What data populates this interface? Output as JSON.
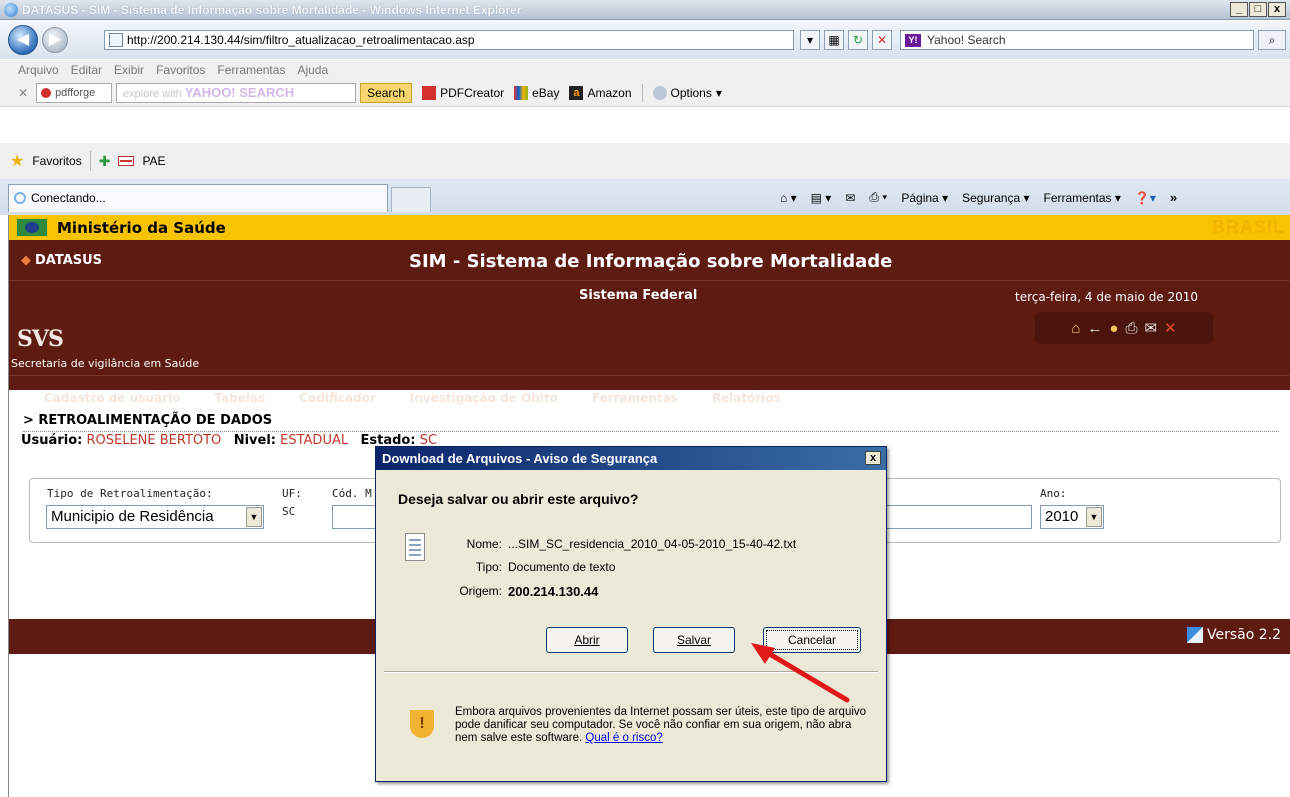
{
  "browser": {
    "window_title": "DATASUS - SIM - Sistema de Informação sobre Mortalidade - Windows Internet Explorer",
    "url": "http://200.214.130.44/sim/filtro_atualizacao_retroalimentacao.asp",
    "search_placeholder": "Yahoo! Search",
    "menu": [
      "Arquivo",
      "Editar",
      "Exibir",
      "Favoritos",
      "Ferramentas",
      "Ajuda"
    ],
    "toolbar": {
      "pdfforge": "pdfforge",
      "yahoo_prefix": "explore with",
      "yahoo_brand": "YAHOO! SEARCH",
      "search_button": "Search",
      "pdfcreator": "PDFCreator",
      "ebay": "eBay",
      "amazon": "Amazon",
      "options": "Options"
    },
    "favorites": {
      "label": "Favoritos",
      "item": "PAE"
    },
    "tab_title": "Conectando...",
    "commands": {
      "pagina": "Página",
      "seguranca": "Segurança",
      "ferramentas": "Ferramentas"
    },
    "window_buttons": {
      "min": "_",
      "max": "□",
      "close": "x"
    },
    "star": "★"
  },
  "site": {
    "ministry": "Ministério da Saúde",
    "brasil_logo": "BRASIL",
    "datasus": "DATASUS",
    "title": "SIM - Sistema de Informação sobre Mortalidade",
    "subtitle": "Sistema Federal",
    "date": "terça-feira, 4 de maio de 2010",
    "svs_logo": "SVS",
    "svs_desc": "Secretaria de vigilância em Saúde",
    "nav": [
      "Cadastro de usuário",
      "Tabelas",
      "Codificador",
      "Investigação de Óbito",
      "Ferramentas",
      "Relatórios"
    ],
    "breadcrumb": "> RETROALIMENTAÇÃO DE DADOS",
    "user": {
      "label_usuario": "Usuário:",
      "usuario": "ROSELENE BERTOTO",
      "label_nivel": "Nivel:",
      "nivel": "ESTADUAL",
      "label_estado": "Estado:",
      "estado": "SC"
    },
    "filter": {
      "tipo_label": "Tipo de Retroalimentação:",
      "tipo_value": "Municipio de Residência",
      "uf_label": "UF:",
      "uf_value": "SC",
      "cod_label": "Cód. M",
      "ano_label": "Ano:",
      "ano_value": "2010"
    },
    "version": "Versão 2.2"
  },
  "dialog": {
    "title": "Download de Arquivos - Aviso de Segurança",
    "question": "Deseja salvar ou abrir este arquivo?",
    "nome_label": "Nome:",
    "nome": "...SIM_SC_residencia_2010_04-05-2010_15-40-42.txt",
    "tipo_label": "Tipo:",
    "tipo": "Documento de texto",
    "origem_label": "Origem:",
    "origem": "200.214.130.44",
    "buttons": {
      "abrir": "Abrir",
      "salvar": "Salvar",
      "cancelar": "Cancelar"
    },
    "warning": "Embora arquivos provenientes da Internet possam ser úteis, este tipo de arquivo pode danificar seu computador. Se você não confiar em sua origem, não abra nem salve este software.",
    "risk_link": "Qual é o risco?",
    "close": "x"
  },
  "colors": {
    "accent_dark": "#5e1b12",
    "ministry_yellow": "#f8c400",
    "arrow": "#e01818"
  }
}
